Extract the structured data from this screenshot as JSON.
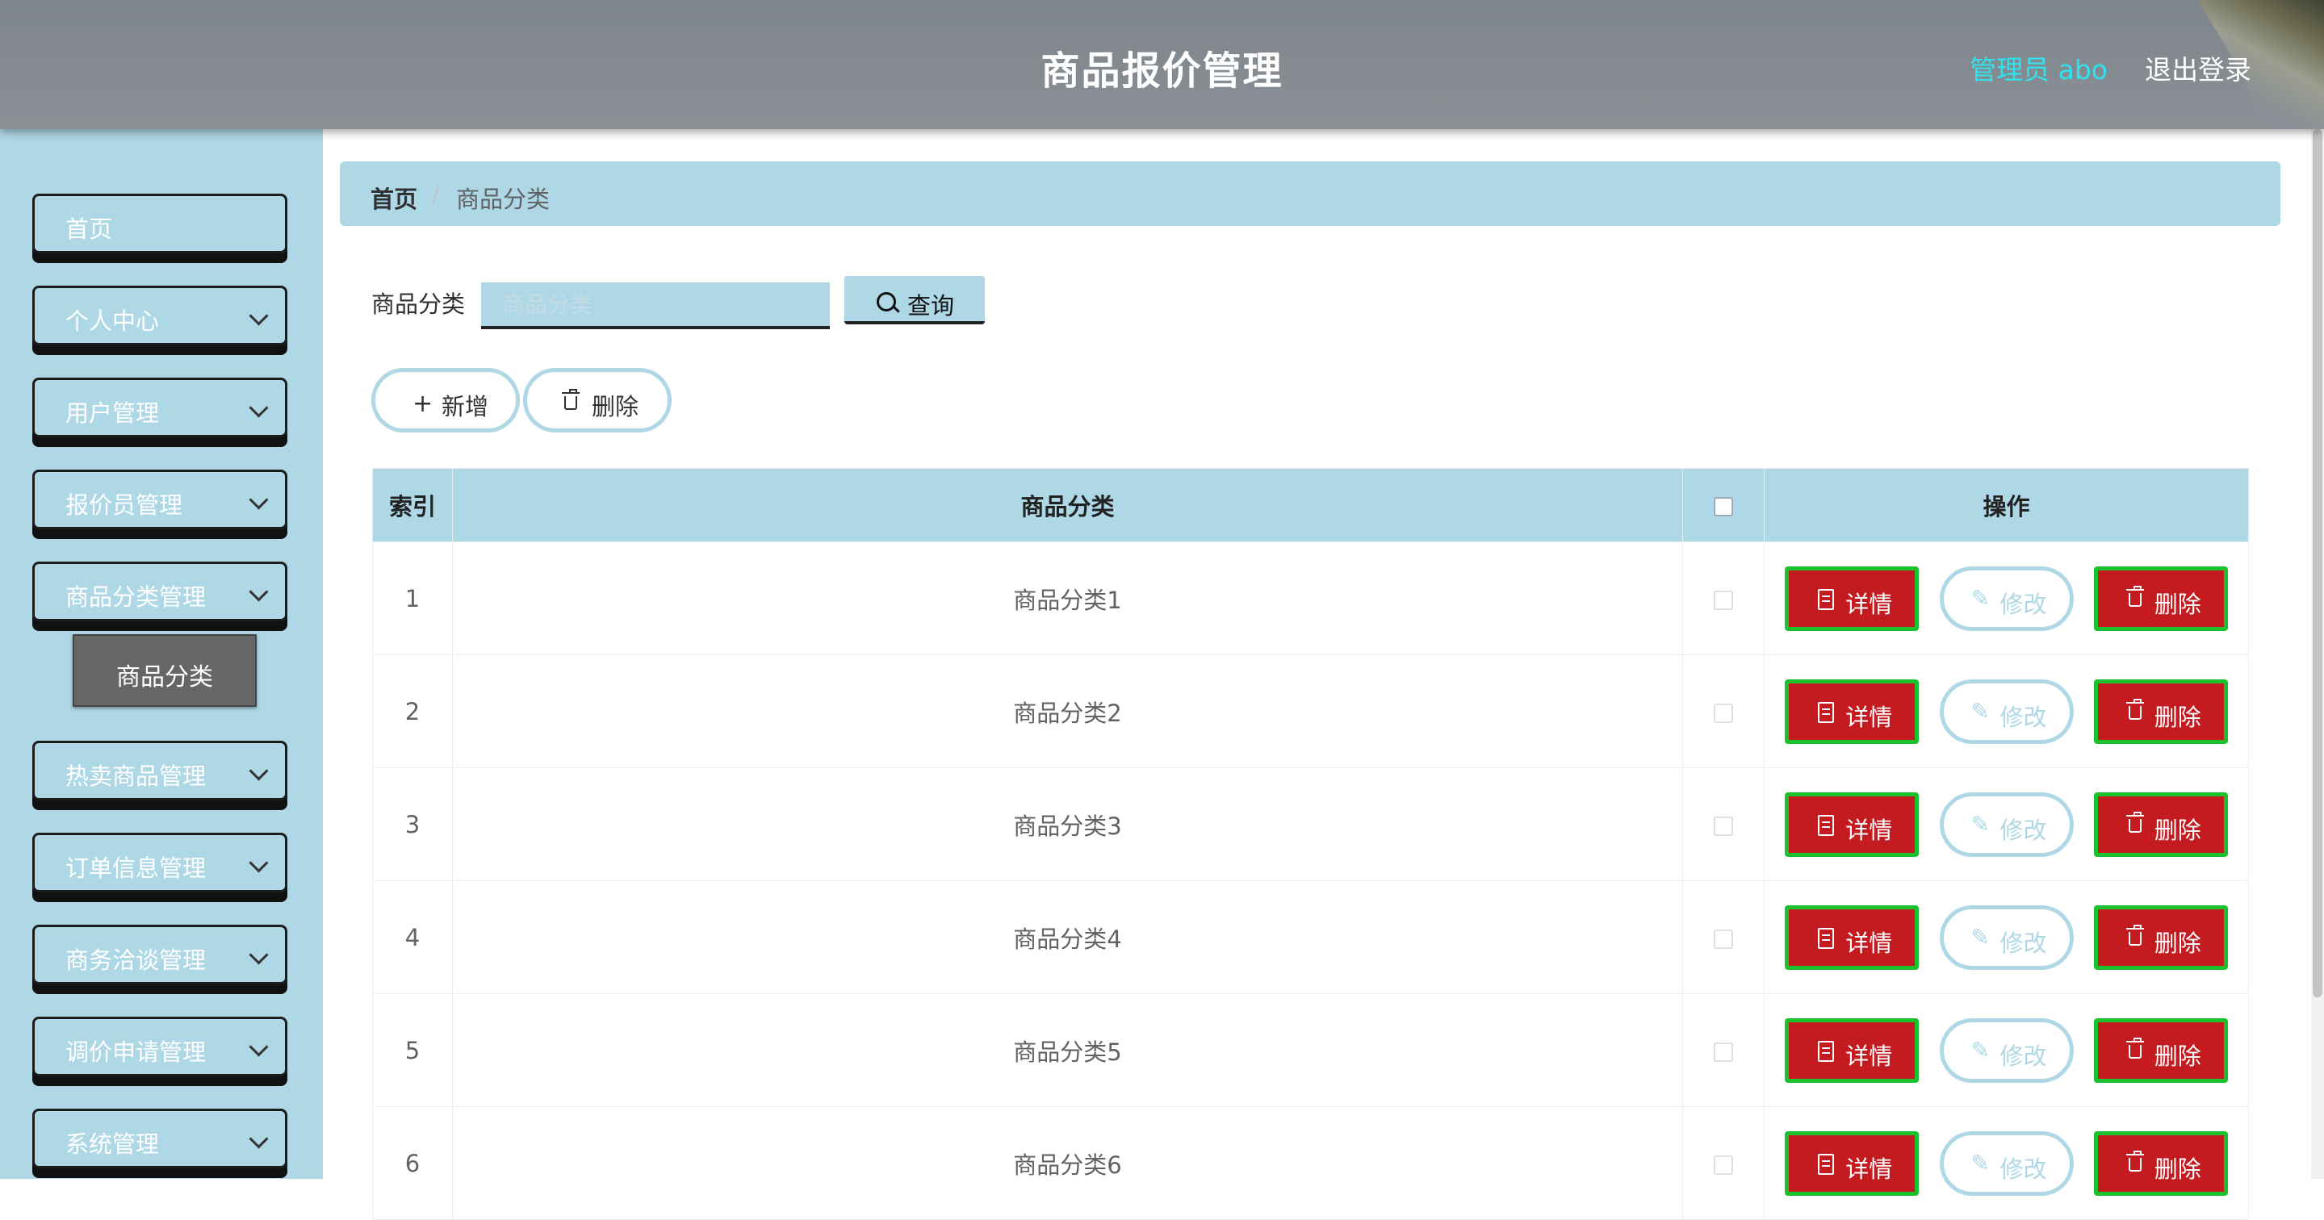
{
  "header": {
    "title": "商品报价管理",
    "user": "管理员 abo",
    "logout": "退出登录"
  },
  "sidebar": {
    "items": [
      {
        "label": "首页",
        "has_chevron": false
      },
      {
        "label": "个人中心",
        "has_chevron": true
      },
      {
        "label": "用户管理",
        "has_chevron": true
      },
      {
        "label": "报价员管理",
        "has_chevron": true
      },
      {
        "label": "商品分类管理",
        "has_chevron": true
      },
      {
        "label": "热卖商品管理",
        "has_chevron": true
      },
      {
        "label": "订单信息管理",
        "has_chevron": true
      },
      {
        "label": "商务洽谈管理",
        "has_chevron": true
      },
      {
        "label": "调价申请管理",
        "has_chevron": true
      },
      {
        "label": "系统管理",
        "has_chevron": true
      }
    ],
    "sub_item": "商品分类"
  },
  "breadcrumb": {
    "home": "首页",
    "separator": "/",
    "current": "商品分类"
  },
  "search": {
    "label": "商品分类",
    "placeholder": "商品分类",
    "button": "查询"
  },
  "actions": {
    "add": "新增",
    "delete": "删除"
  },
  "table": {
    "headers": {
      "index": "索引",
      "category": "商品分类",
      "operations": "操作"
    },
    "rows": [
      {
        "index": "1",
        "category": "商品分类1"
      },
      {
        "index": "2",
        "category": "商品分类2"
      },
      {
        "index": "3",
        "category": "商品分类3"
      },
      {
        "index": "4",
        "category": "商品分类4"
      },
      {
        "index": "5",
        "category": "商品分类5"
      },
      {
        "index": "6",
        "category": "商品分类6"
      }
    ],
    "row_actions": {
      "detail": "详情",
      "edit": "修改",
      "delete": "删除"
    }
  },
  "colors": {
    "accent": "#aed8e6",
    "header_bg": "#868c91",
    "danger": "#c41b20",
    "danger_border": "#19c12d",
    "user_text": "#2fe3ee"
  }
}
